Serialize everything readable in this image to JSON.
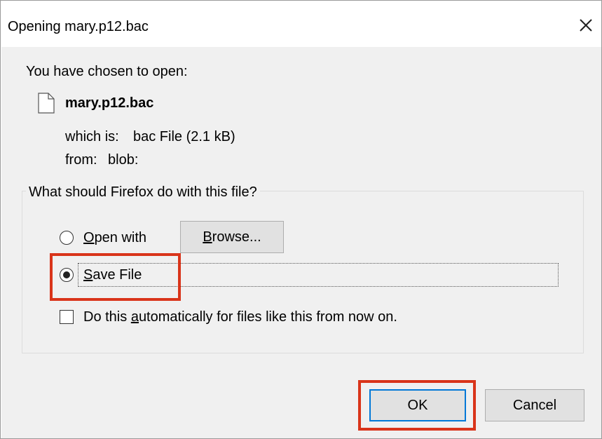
{
  "dialog": {
    "title": "Opening mary.p12.bac",
    "close_icon": "close-icon"
  },
  "info": {
    "chosen_label": "You have chosen to open:",
    "file_icon": "file-icon",
    "file_name": "mary.p12.bac",
    "which_is_label": "which is:",
    "which_is_value": "bac File (2.1 kB)",
    "from_label": "from:",
    "from_value": "blob:"
  },
  "action_group": {
    "legend": "What should Firefox do with this file?",
    "open_with": {
      "label": "Open with",
      "mnemonic": "O",
      "rest": "pen with",
      "selected": false
    },
    "browse_button": {
      "mnemonic": "B",
      "rest": "rowse..."
    },
    "save_file": {
      "label": "Save File",
      "mnemonic": "S",
      "rest": "ave File",
      "selected": true
    },
    "auto_checkbox": {
      "pre": "Do this ",
      "mnemonic": "a",
      "post": "utomatically for files like this from now on.",
      "checked": false
    }
  },
  "buttons": {
    "ok": "OK",
    "cancel": "Cancel"
  },
  "colors": {
    "highlight": "#d9341a",
    "default_button_border": "#0078d7",
    "panel_background": "#f0f0f0"
  }
}
